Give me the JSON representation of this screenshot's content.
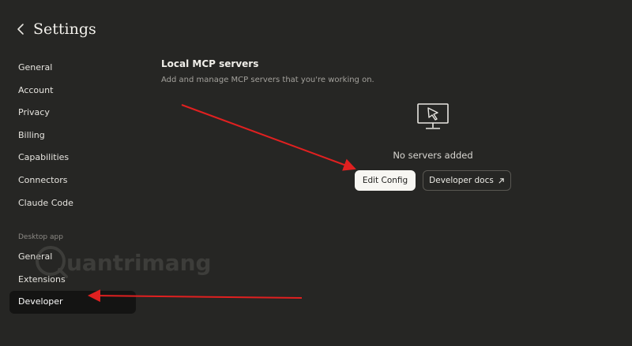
{
  "header": {
    "title": "Settings",
    "back_icon": "chevron-left-icon"
  },
  "sidebar": {
    "items": [
      {
        "label": "General"
      },
      {
        "label": "Account"
      },
      {
        "label": "Privacy"
      },
      {
        "label": "Billing"
      },
      {
        "label": "Capabilities"
      },
      {
        "label": "Connectors"
      },
      {
        "label": "Claude Code"
      }
    ],
    "desktop_section_label": "Desktop app",
    "desktop_items": [
      {
        "label": "General"
      },
      {
        "label": "Extensions"
      },
      {
        "label": "Developer",
        "active": true
      }
    ]
  },
  "main": {
    "title": "Local MCP servers",
    "subtitle": "Add and manage MCP servers that you're working on.",
    "empty_icon": "monitor-cursor-icon",
    "empty_text": "No servers added",
    "edit_config_label": "Edit Config",
    "developer_docs_label": "Developer docs",
    "external_icon": "arrow-up-right-icon"
  },
  "watermark": {
    "text": "uantrimang"
  },
  "colors": {
    "background": "#262624",
    "annotation_arrow": "#e02020",
    "active_item_bg": "#141413"
  }
}
